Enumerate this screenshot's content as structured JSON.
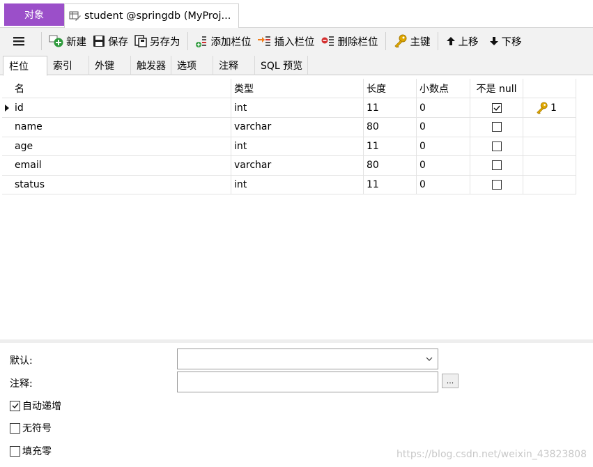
{
  "tabs": {
    "objects": "对象",
    "document": "student @springdb (MyProj..."
  },
  "toolbar": {
    "new": "新建",
    "save": "保存",
    "save_as": "另存为",
    "add_field": "添加栏位",
    "insert_field": "插入栏位",
    "delete_field": "删除栏位",
    "primary_key": "主键",
    "move_up": "上移",
    "move_down": "下移"
  },
  "subtabs": [
    "栏位",
    "索引",
    "外键",
    "触发器",
    "选项",
    "注释",
    "SQL 预览"
  ],
  "grid": {
    "headers": [
      "名",
      "类型",
      "长度",
      "小数点",
      "不是 null",
      ""
    ],
    "rows": [
      {
        "name": "id",
        "type": "int",
        "length": "11",
        "decimals": "0",
        "not_null": true,
        "key": "1"
      },
      {
        "name": "name",
        "type": "varchar",
        "length": "80",
        "decimals": "0",
        "not_null": false,
        "key": ""
      },
      {
        "name": "age",
        "type": "int",
        "length": "11",
        "decimals": "0",
        "not_null": false,
        "key": ""
      },
      {
        "name": "email",
        "type": "varchar",
        "length": "80",
        "decimals": "0",
        "not_null": false,
        "key": ""
      },
      {
        "name": "status",
        "type": "int",
        "length": "11",
        "decimals": "0",
        "not_null": false,
        "key": ""
      }
    ]
  },
  "props": {
    "default_label": "默认:",
    "default_value": "",
    "comment_label": "注释:",
    "comment_value": "",
    "ellipsis": "...",
    "auto_increment": {
      "label": "自动递增",
      "checked": true
    },
    "unsigned": {
      "label": "无符号",
      "checked": false
    },
    "zerofill": {
      "label": "填充零",
      "checked": false
    }
  },
  "watermark": "https://blog.csdn.net/weixin_43823808",
  "colors": {
    "objects_tab": "#9b4fc9",
    "toolbar_bg": "#f2f2f2",
    "key_gold": "#e0a800",
    "add_green": "#2e9a3c",
    "delete_red": "#d32f2f",
    "insert_orange": "#f07d1a"
  }
}
